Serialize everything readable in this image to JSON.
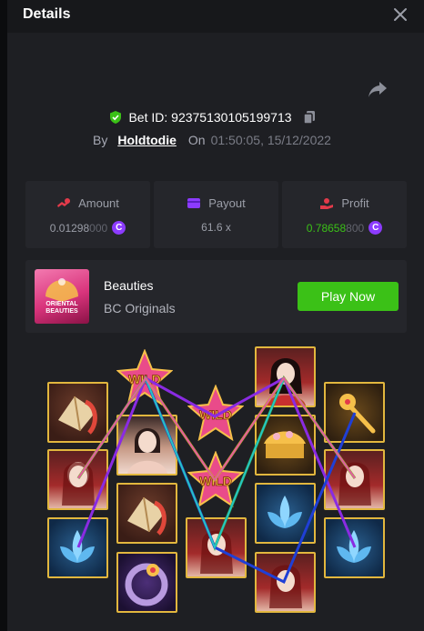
{
  "header": {
    "title": "Details"
  },
  "bet": {
    "id_label": "Bet ID: 92375130105199713",
    "by_label": "By",
    "user": "Holdtodie",
    "on_label": "On",
    "time": "01:50:05, 15/12/2022"
  },
  "stats": {
    "amount": {
      "label": "Amount",
      "value": "0.01298",
      "value_dim": "000"
    },
    "payout": {
      "label": "Payout",
      "value": "61.6 x"
    },
    "profit": {
      "label": "Profit",
      "value": "0.78658",
      "value_dim": "800"
    }
  },
  "coin_symbol": "C",
  "game": {
    "name": "Beauties",
    "provider": "BC Originals",
    "thumb_text_1": "ORIENTAL",
    "thumb_text_2": "BEAUTIES",
    "play_label": "Play Now"
  },
  "wild_text": "WILD",
  "symbols": {
    "reel_1": [
      "folding-fan",
      "beauty-red-hair",
      "blue-lotus"
    ],
    "reel_2": [
      "wild",
      "beauty-portrait",
      "folding-fan",
      "jade-ring"
    ],
    "reel_3": [
      "wild",
      "wild",
      "beauty-red-hair"
    ],
    "reel_4": [
      "beauty-black-hair",
      "golden-comb",
      "blue-lotus",
      "beauty-red-hair"
    ],
    "reel_5": [
      "golden-hairpin",
      "beauty-red-hair",
      "blue-lotus"
    ]
  },
  "paylines": [
    {
      "color": "#8a2be2",
      "stops": [
        3,
        1,
        2,
        1,
        3
      ]
    },
    {
      "color": "#2aa84a",
      "stops": [
        2,
        1,
        3,
        1,
        2
      ]
    },
    {
      "color": "#1f3fd6",
      "stops": [
        2,
        1,
        3,
        4,
        1
      ]
    },
    {
      "color": "#c0b21a",
      "stops": [
        2,
        1,
        2,
        1,
        2
      ]
    },
    {
      "color": "#26c4c4",
      "stops": [
        2,
        1,
        3,
        1,
        2
      ]
    },
    {
      "color": "#e35aa0",
      "stops": [
        2,
        1,
        2,
        1,
        2
      ]
    }
  ],
  "colors": {
    "accent_green": "#3bc117",
    "profit_green": "#3bc117",
    "coin_purple": "#8c3bff",
    "tile_border": "#e2b73e",
    "shield_green": "#3bc117",
    "icon_red": "#e23a4a",
    "icon_purple": "#8c3bff"
  }
}
